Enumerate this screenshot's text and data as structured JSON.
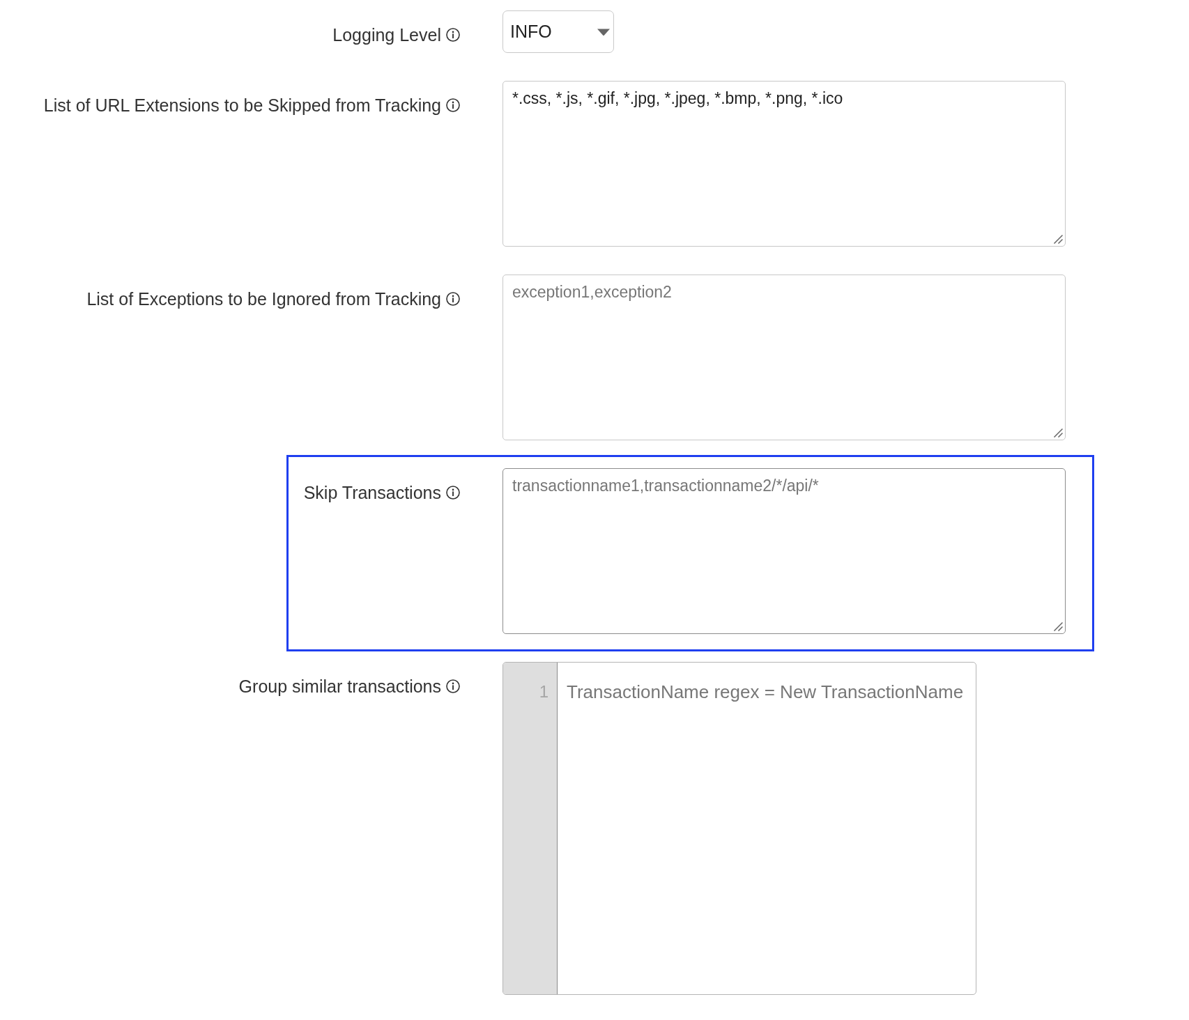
{
  "fields": [
    {
      "kind": "select",
      "label": "Logging Level",
      "value": "INFO",
      "highlighted": false
    },
    {
      "kind": "textarea",
      "label": "List of URL Extensions to be Skipped from Tracking",
      "value": "*.css, *.js, *.gif, *.jpg, *.jpeg, *.bmp, *.png, *.ico",
      "highlighted": false
    },
    {
      "kind": "textarea",
      "label": "List of Exceptions to be Ignored from Tracking",
      "placeholder": "exception1,exception2",
      "highlighted": false
    },
    {
      "kind": "textarea",
      "label": "Skip Transactions",
      "placeholder": "transactionname1,transactionname2/*/api/*",
      "highlighted": true
    },
    {
      "kind": "code",
      "label": "Group similar transactions",
      "line_numbers": [
        "1"
      ],
      "placeholder": "TransactionName regex = New TransactionName",
      "highlighted": false
    }
  ]
}
